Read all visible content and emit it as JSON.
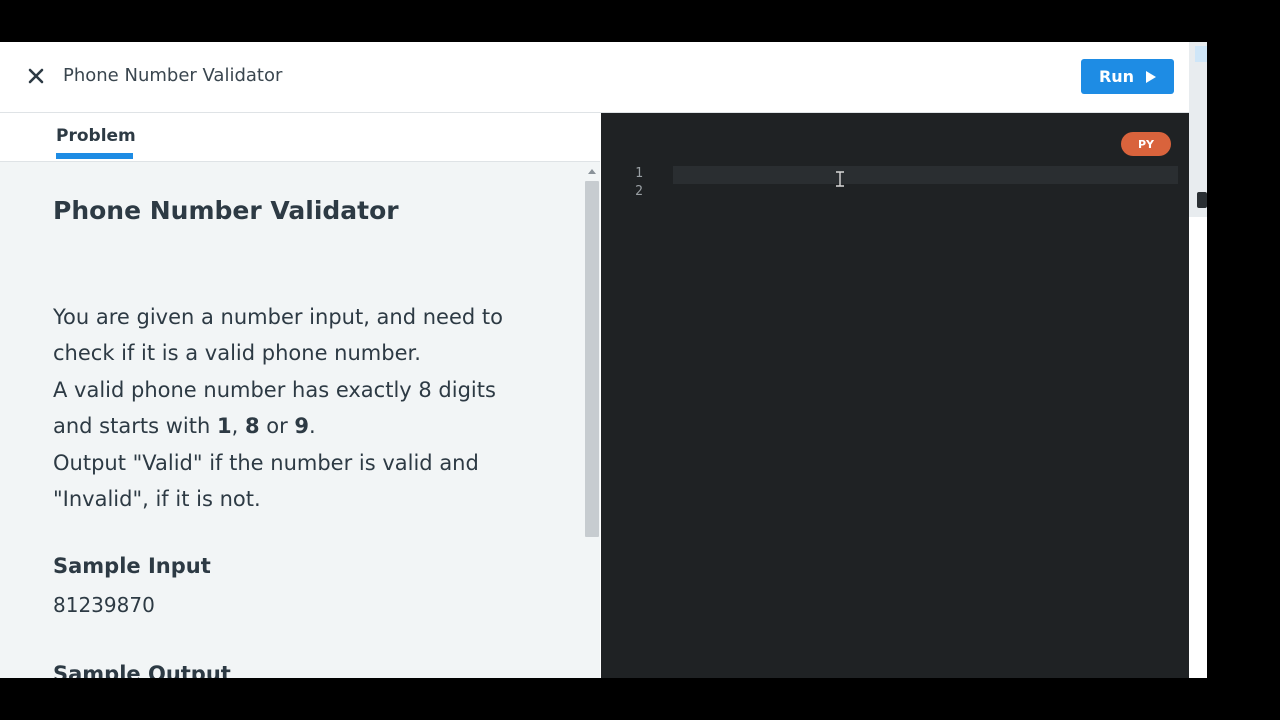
{
  "header": {
    "title": "Phone Number Validator",
    "run_label": "Run"
  },
  "tabs": [
    {
      "label": "Problem",
      "active": true
    }
  ],
  "problem": {
    "title": "Phone Number Validator",
    "desc_line1": "You are given a number input, and need to check if it is a valid phone number.",
    "desc_line2_pre": "A valid phone number has exactly 8 digits and starts with ",
    "digit1": "1",
    "comma": ", ",
    "digit2": "8",
    "or_text": " or ",
    "digit3": "9",
    "period": ".",
    "desc_line3": "Output \"Valid\" if the number is valid and \"Invalid\", if it is not.",
    "sample_input_heading": "Sample Input",
    "sample_input_value": "81239870",
    "sample_output_heading": "Sample Output"
  },
  "editor": {
    "language_badge": "PY",
    "line_numbers": [
      "1",
      "2"
    ]
  },
  "colors": {
    "accent": "#1e8ce4",
    "badge": "#d9633c",
    "editor_bg": "#1f2224"
  }
}
